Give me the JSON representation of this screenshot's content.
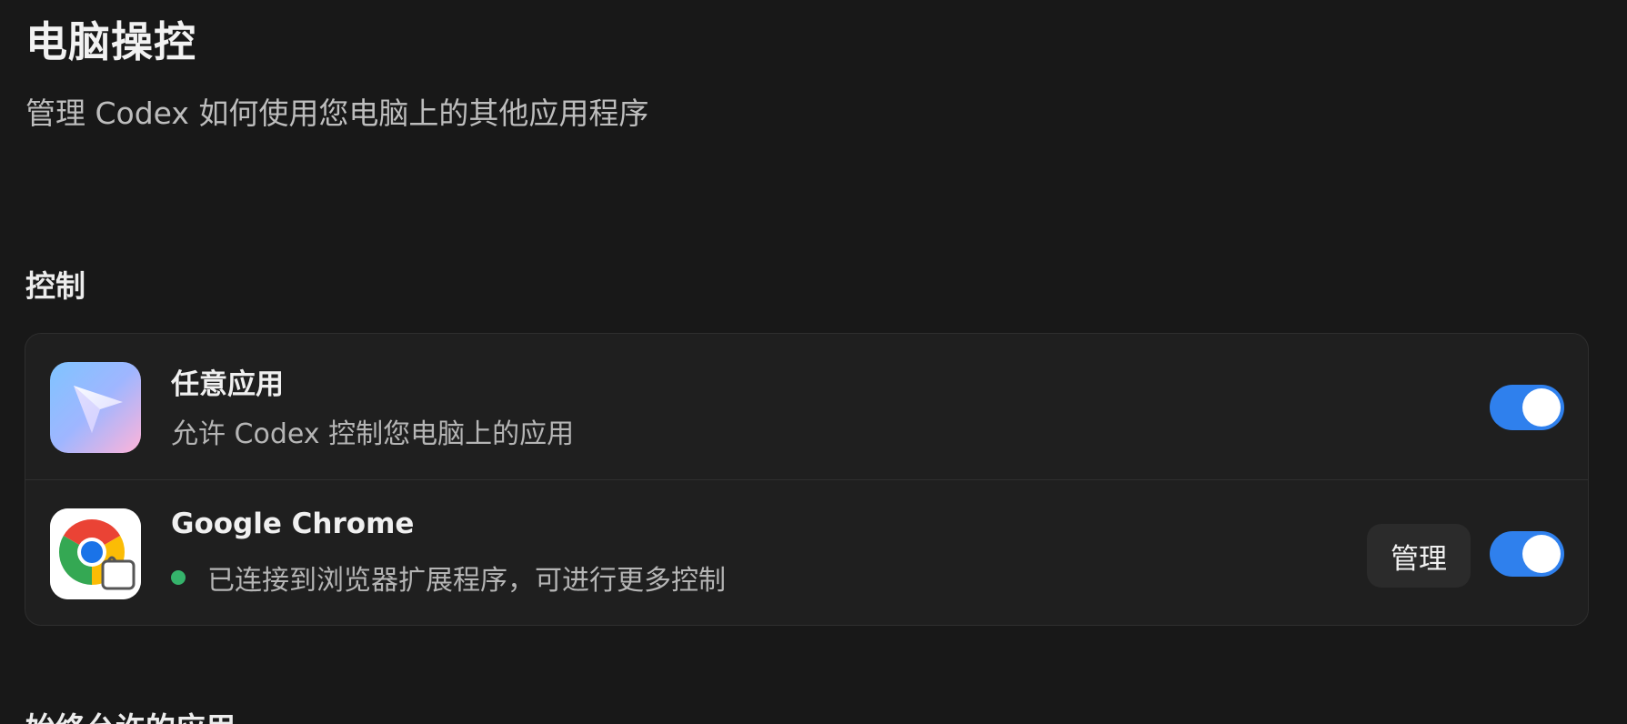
{
  "page": {
    "title": "电脑操控",
    "subtitle": "管理 Codex 如何使用您电脑上的其他应用程序"
  },
  "control_section": {
    "heading": "控制",
    "rows": [
      {
        "title": "任意应用",
        "description": "允许 Codex 控制您电脑上的应用",
        "icon": "codex-app-icon",
        "toggle_on": true
      },
      {
        "title": "Google Chrome",
        "description": "已连接到浏览器扩展程序，可进行更多控制",
        "icon": "chrome-icon",
        "status": "connected",
        "manage_label": "管理",
        "toggle_on": true
      }
    ]
  },
  "always_allowed_section": {
    "heading": "始终允许的应用"
  },
  "colors": {
    "background": "#181818",
    "card": "#1f1f1f",
    "toggle_on": "#2f80ed",
    "status_connected": "#35b36b"
  }
}
